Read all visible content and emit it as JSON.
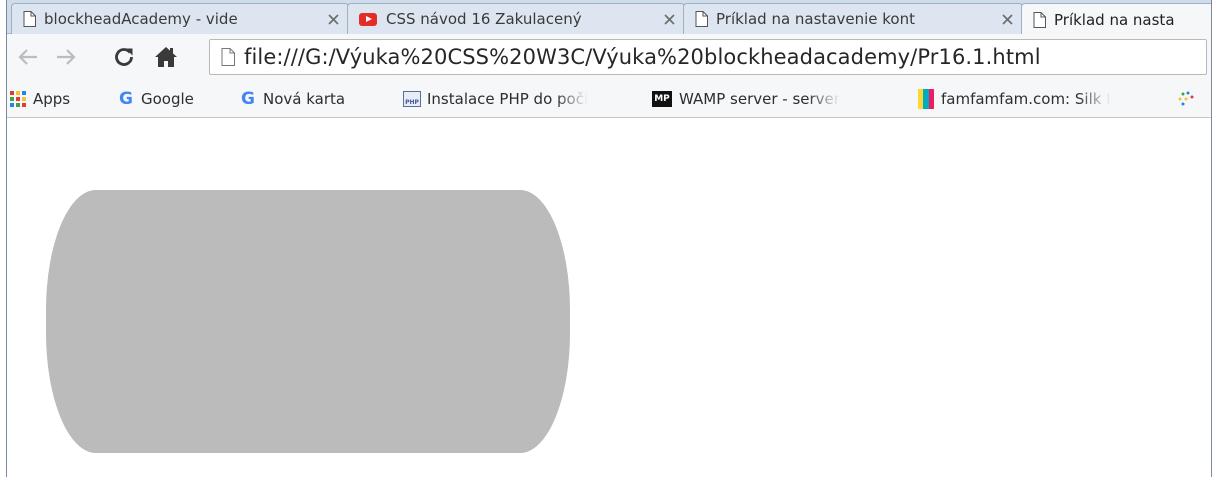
{
  "tabs": [
    {
      "label": "blockheadAcademy - vide",
      "icon": "page-icon",
      "active": false
    },
    {
      "label": "CSS návod 16 Zakulacený",
      "icon": "youtube-icon",
      "active": false
    },
    {
      "label": "Príklad na nastavenie kont",
      "icon": "page-icon",
      "active": false
    },
    {
      "label": "Príklad na nasta",
      "icon": "page-icon",
      "active": true
    }
  ],
  "toolbar": {
    "back_icon": "back-arrow-icon",
    "forward_icon": "forward-arrow-icon",
    "reload_icon": "reload-icon",
    "home_icon": "home-icon",
    "url": "file:///G:/Výuka%20CSS%20W3C/Výuka%20blockheadacademy/Pr16.1.html"
  },
  "bookmarks": [
    {
      "label": "Apps",
      "icon": "apps-grid-icon"
    },
    {
      "label": "Google",
      "icon": "google-icon"
    },
    {
      "label": "Nová karta",
      "icon": "google-icon"
    },
    {
      "label": "Instalace PHP do počí",
      "icon": "php-icon"
    },
    {
      "label": "WAMP server - server",
      "icon": "mp-icon"
    },
    {
      "label": "famfamfam.com: Silk I",
      "icon": "color-stripes-icon"
    },
    {
      "label": "",
      "icon": "sparkle-icon"
    }
  ],
  "content": {
    "box_color": "#bbbbbb"
  },
  "colors": {
    "tabstrip": "#cfdcea",
    "toolbar": "#f6f7f8",
    "youtube_red": "#e52d27",
    "google_blue": "#4285f4"
  }
}
